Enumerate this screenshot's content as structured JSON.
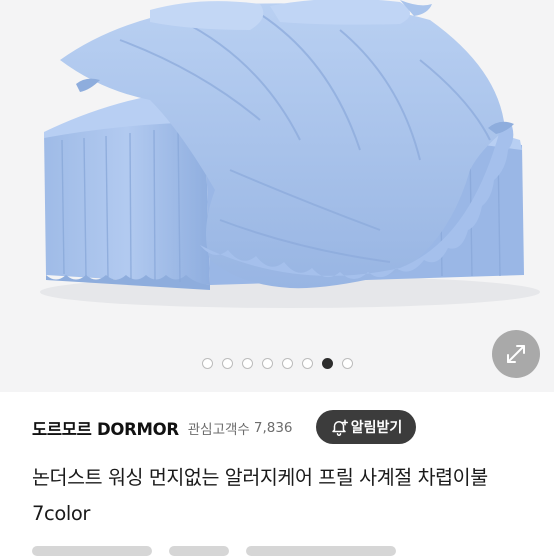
{
  "gallery": {
    "photo_alt": "blue frilled comforter and bed skirt on a bed",
    "image_count": 8,
    "active_index": 6,
    "expand_icon": "expand-arrows-icon"
  },
  "brand": {
    "name": "도르모르 DORMOR",
    "favorites_label": "관심고객수",
    "favorites_count": "7,836",
    "alarm_button_label": "알림받기",
    "alarm_icon": "bell-plus-icon"
  },
  "product": {
    "title": "논더스트 워싱 먼지없는 알러지케어 프릴 사계절 차렵이불 7color"
  },
  "colors": {
    "bedding_blue": "#a9c4ec",
    "active_dot": "#2d2d2d",
    "alarm_button_bg": "#3c3c3c"
  }
}
